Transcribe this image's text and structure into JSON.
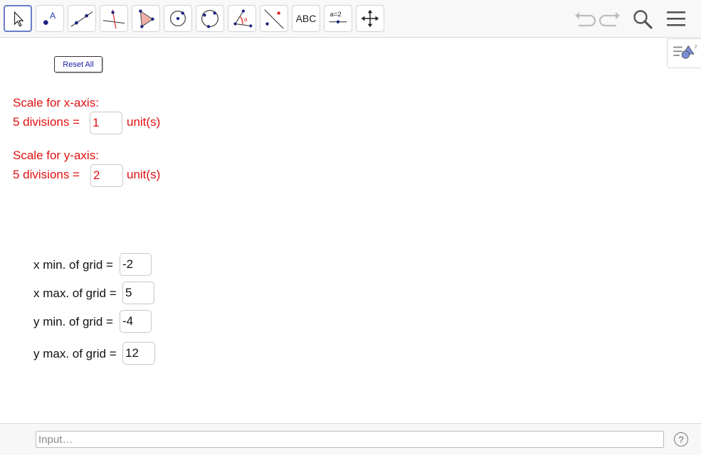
{
  "toolbar": {
    "tools": [
      {
        "name": "move-tool",
        "label": ""
      },
      {
        "name": "point-tool",
        "label": "A"
      },
      {
        "name": "line-tool",
        "label": ""
      },
      {
        "name": "perpendicular-line-tool",
        "label": ""
      },
      {
        "name": "polygon-tool",
        "label": ""
      },
      {
        "name": "circle-center-tool",
        "label": ""
      },
      {
        "name": "circle-three-points-tool",
        "label": ""
      },
      {
        "name": "angle-tool",
        "label": "α"
      },
      {
        "name": "reflect-tool",
        "label": ""
      },
      {
        "name": "text-tool",
        "label": "ABC"
      },
      {
        "name": "slider-tool",
        "label": "a=2"
      },
      {
        "name": "move-graphics-tool",
        "label": ""
      }
    ],
    "icons": [
      "undo-icon",
      "redo-icon",
      "search-icon",
      "menu-icon"
    ]
  },
  "reset_button": "Reset All",
  "x_scale": {
    "heading": "Scale for x-axis:",
    "prefix": "5 divisions =",
    "value": "1",
    "suffix": "unit(s)"
  },
  "y_scale": {
    "heading": "Scale for y-axis:",
    "prefix": "5 divisions =",
    "value": "2",
    "suffix": "unit(s)"
  },
  "grid": {
    "x_min_label": "x min. of grid =",
    "x_min_value": "-2",
    "x_max_label": "x max. of grid =",
    "x_max_value": "5",
    "y_min_label": "y min. of grid =",
    "y_min_value": "-4",
    "y_max_label": "y max. of grid =",
    "y_max_value": "12"
  },
  "input_bar": {
    "placeholder": "Input…",
    "help": "?"
  },
  "colors": {
    "accent_red": "#e01010",
    "tool_selected_border": "#6a7ec8",
    "point_blue": "#1a237e"
  }
}
